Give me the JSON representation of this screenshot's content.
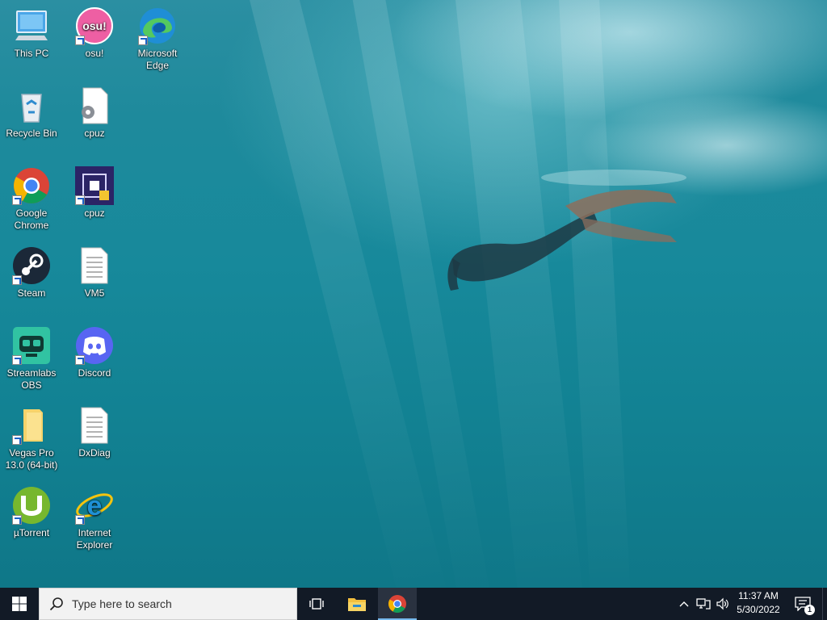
{
  "desktop": {
    "wallpaper": "underwater freediver",
    "colors": {
      "water_top": "#2b8fa2",
      "water_bottom": "#0f7788"
    },
    "icons": [
      {
        "label": "This PC",
        "icon": "computer-icon",
        "shortcut": false
      },
      {
        "label": "osu!",
        "icon": "osu-icon",
        "shortcut": true
      },
      {
        "label": "Microsoft Edge",
        "icon": "edge-icon",
        "shortcut": true
      },
      {
        "label": "Recycle Bin",
        "icon": "recycle-bin-icon",
        "shortcut": false
      },
      {
        "label": "cpuz",
        "icon": "file-gear-icon",
        "shortcut": false
      },
      {
        "label": "Google Chrome",
        "icon": "chrome-icon",
        "shortcut": true
      },
      {
        "label": "cpuz",
        "icon": "cpuz-icon",
        "shortcut": true
      },
      {
        "label": "Steam",
        "icon": "steam-icon",
        "shortcut": true
      },
      {
        "label": "VM5",
        "icon": "text-file-icon",
        "shortcut": false
      },
      {
        "label": "Streamlabs OBS",
        "icon": "streamlabs-icon",
        "shortcut": true
      },
      {
        "label": "Discord",
        "icon": "discord-icon",
        "shortcut": true
      },
      {
        "label": "Vegas Pro 13.0 (64-bit)",
        "icon": "folder-icon",
        "shortcut": true
      },
      {
        "label": "DxDiag",
        "icon": "text-file-icon",
        "shortcut": false
      },
      {
        "label": "µTorrent",
        "icon": "utorrent-icon",
        "shortcut": true
      },
      {
        "label": "Internet Explorer",
        "icon": "ie-icon",
        "shortcut": true
      }
    ]
  },
  "taskbar": {
    "search_placeholder": "Type here to search",
    "pinned": [
      {
        "name": "task-view",
        "icon": "task-view-icon"
      },
      {
        "name": "file-explorer",
        "icon": "folder-icon"
      },
      {
        "name": "google-chrome",
        "icon": "chrome-icon",
        "active": true
      }
    ],
    "tray": {
      "time": "11:37 AM",
      "date": "5/30/2022",
      "notification_count": "1",
      "icons": [
        "chevron-up-icon",
        "network-icon",
        "volume-icon",
        "notification-icon"
      ]
    },
    "colors": {
      "background": "#121a26",
      "active_underline": "#76b9ed"
    }
  }
}
